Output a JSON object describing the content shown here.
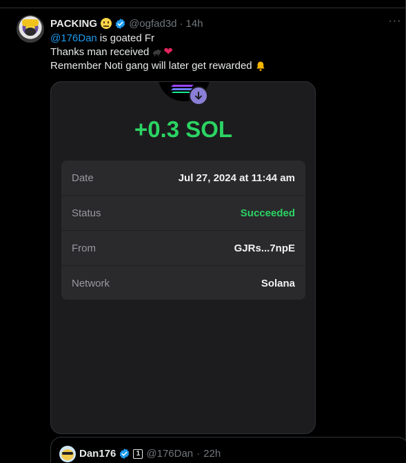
{
  "tweet": {
    "author_name": "PACKING",
    "author_handle": "@ogfad3d",
    "separator": "·",
    "time": "14h",
    "more_label": "···",
    "lines": {
      "mention": "@176Dan",
      "line1_rest": "is goated Fr",
      "line2": "Thanks man received",
      "line3": "Remember Noti gang will later get rewarded"
    },
    "heart_glyph": "❤"
  },
  "receipt": {
    "amount": "+0.3 SOL",
    "rows": [
      {
        "label": "Date",
        "value": "Jul 27, 2024 at 11:44 am"
      },
      {
        "label": "Status",
        "value": "Succeeded"
      },
      {
        "label": "From",
        "value": "GJRs...7npE"
      },
      {
        "label": "Network",
        "value": "Solana"
      }
    ]
  },
  "quoted": {
    "author_name": "Dan176",
    "affiliate_badge": "1",
    "author_handle": "@176Dan",
    "separator": "·",
    "time": "22h"
  },
  "colors": {
    "accent_blue": "#1d9bf0",
    "success_green": "#2bd463",
    "muted": "#71767b"
  },
  "icons": [
    "neutral-face-emoji-icon",
    "verified-badge-icon",
    "horse-emoji-icon",
    "heart-emoji-icon",
    "bell-emoji-icon",
    "solana-logo-icon",
    "arrow-down-icon",
    "more-options-icon"
  ]
}
